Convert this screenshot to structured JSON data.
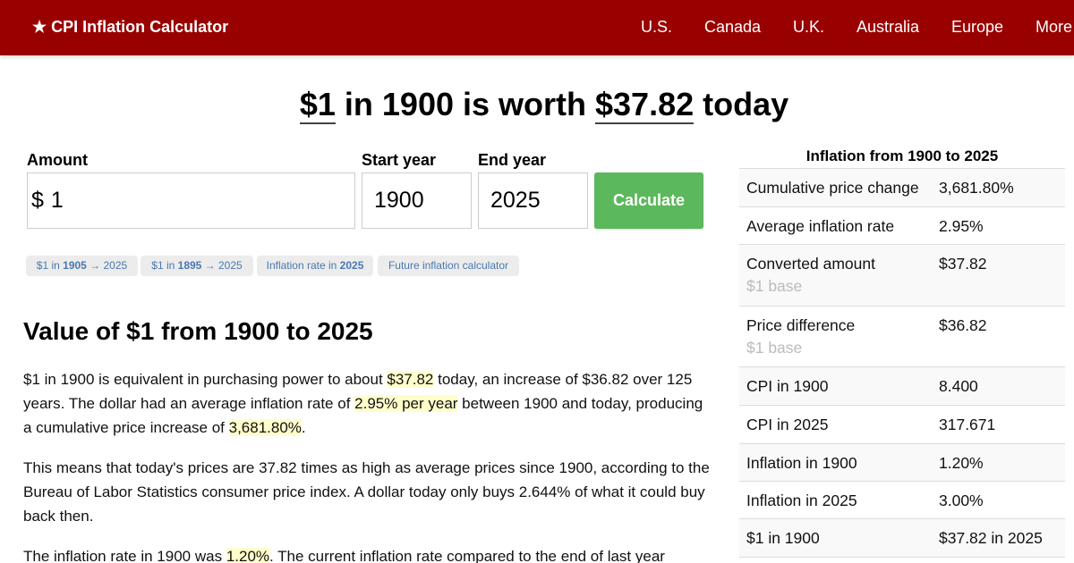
{
  "header": {
    "brand": "CPI Inflation Calculator",
    "brand_icon": "star-icon",
    "nav": [
      "U.S.",
      "Canada",
      "U.K.",
      "Australia",
      "Europe",
      "More"
    ]
  },
  "headline": {
    "amount": "$1",
    "mid": "in 1900 is worth",
    "result": "$37.82",
    "tail": "today"
  },
  "form": {
    "amount_label": "Amount",
    "currency_symbol": "$",
    "amount_value": "1",
    "start_label": "Start year",
    "start_value": "1900",
    "end_label": "End year",
    "end_value": "2025",
    "calculate_label": "Calculate",
    "calculate_color": "#5cb85c"
  },
  "quick_links": [
    {
      "pre": "$1 in ",
      "bold": "1905",
      "post": " → 2025"
    },
    {
      "pre": "$1 in ",
      "bold": "1895",
      "post": " → 2025"
    },
    {
      "pre": "Inflation rate in ",
      "bold": "2025",
      "post": ""
    },
    {
      "pre": "Future inflation calculator",
      "bold": "",
      "post": ""
    }
  ],
  "article": {
    "heading": "Value of $1 from 1900 to 2025",
    "p1": {
      "a": "$1 in 1900 is equivalent in purchasing power to about ",
      "h1": "$37.82",
      "b": " today, an increase of $36.82 over 125 years. The dollar had an average inflation rate of ",
      "h2": "2.95% per year",
      "c": " between 1900 and today, producing a cumulative price increase of ",
      "h3": "3,681.80%",
      "d": "."
    },
    "p2": "This means that today's prices are 37.82 times as high as average prices since 1900, according to the Bureau of Labor Statistics consumer price index. A dollar today only buys 2.644% of what it could buy back then.",
    "p3": {
      "a": "The inflation rate in 1900 was ",
      "h1": "1.20%",
      "b": ". The current inflation rate compared to the end of last year"
    }
  },
  "side_table": {
    "title": "Inflation from 1900 to 2025",
    "rows": [
      {
        "label": "Cumulative price change",
        "value": "3,681.80%",
        "sub": ""
      },
      {
        "label": "Average inflation rate",
        "value": "2.95%",
        "sub": ""
      },
      {
        "label": "Converted amount",
        "value": "$37.82",
        "sub": "$1 base"
      },
      {
        "label": "Price difference",
        "value": "$36.82",
        "sub": "$1 base"
      },
      {
        "label": "CPI in 1900",
        "value": "8.400",
        "sub": ""
      },
      {
        "label": "CPI in 2025",
        "value": "317.671",
        "sub": ""
      },
      {
        "label": "Inflation in 1900",
        "value": "1.20%",
        "sub": ""
      },
      {
        "label": "Inflation in 2025",
        "value": "3.00%",
        "sub": ""
      },
      {
        "label": "$1 in 1900",
        "value": "$37.82 in 2025",
        "sub": ""
      }
    ]
  },
  "colors": {
    "brand": "#990000",
    "link": "#4a78b0",
    "highlight": "#ffffcc"
  }
}
